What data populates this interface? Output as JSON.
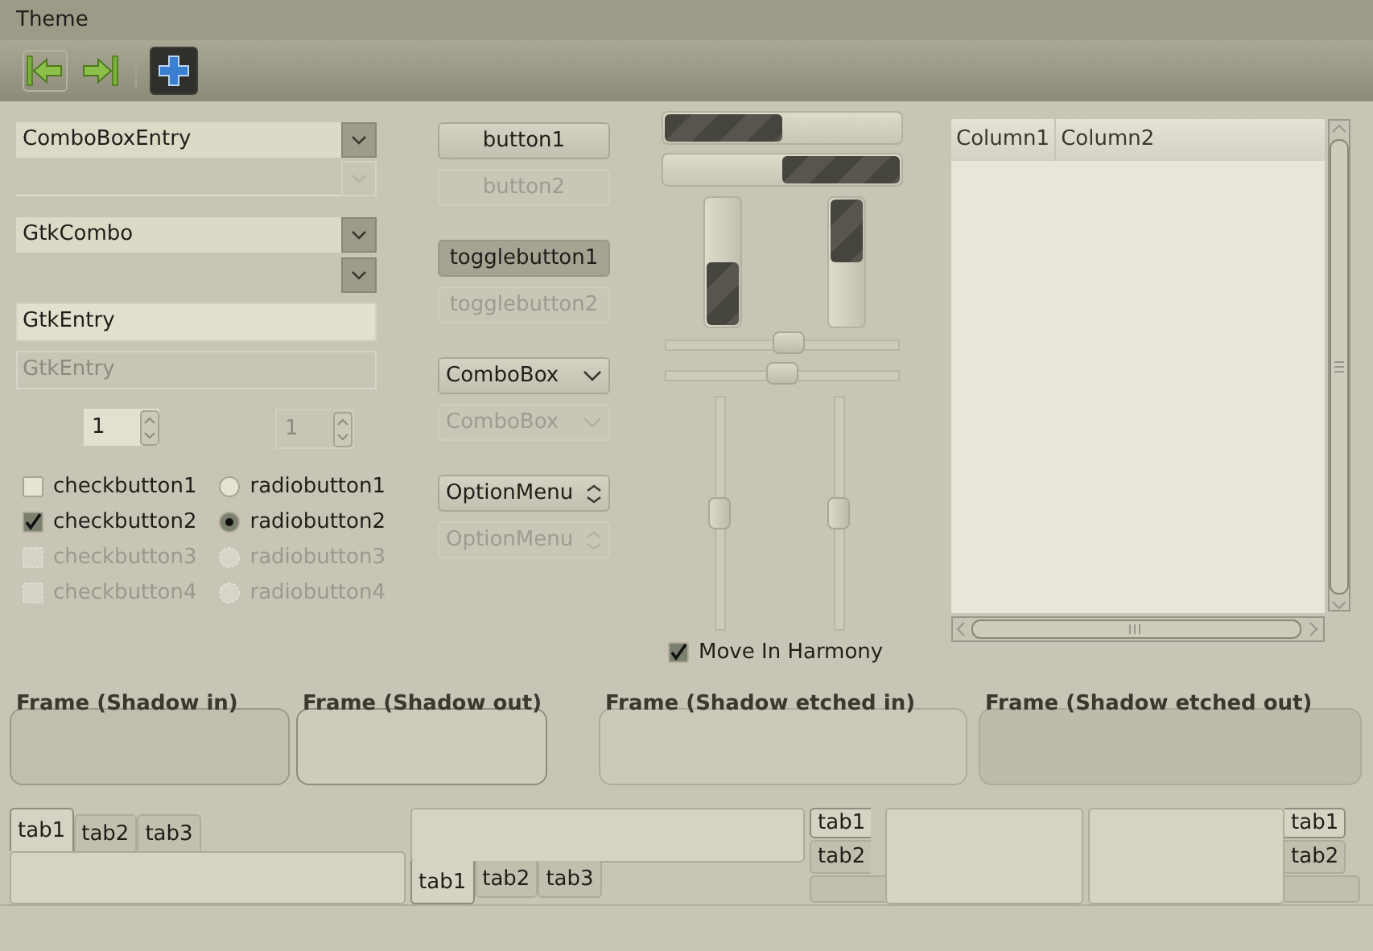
{
  "window": {
    "title": "Theme"
  },
  "toolbar": [
    {
      "kind": "first"
    },
    {
      "kind": "last"
    },
    {
      "kind": "separator"
    },
    {
      "kind": "add"
    }
  ],
  "combo_box_entries": [
    {
      "value": "ComboBoxEntry",
      "disabled": false
    },
    {
      "disabled": true
    }
  ],
  "gtk_combo": {
    "value": "GtkCombo"
  },
  "entries": [
    {
      "value": "GtkEntry",
      "disabled": false
    },
    {
      "value": "GtkEntry",
      "disabled": true
    }
  ],
  "spin_buttons": [
    {
      "value": "1",
      "disabled": false
    },
    {
      "value": "1",
      "disabled": true
    }
  ],
  "check_buttons": [
    {
      "label": "checkbutton1",
      "checked": false,
      "disabled": false
    },
    {
      "label": "checkbutton2",
      "checked": true,
      "disabled": false
    },
    {
      "label": "checkbutton3",
      "checked": false,
      "disabled": true
    },
    {
      "label": "checkbutton4",
      "checked": false,
      "disabled": true
    }
  ],
  "radio_buttons": [
    {
      "label": "radiobutton1",
      "selected": false,
      "disabled": false
    },
    {
      "label": "radiobutton2",
      "selected": true,
      "disabled": false
    },
    {
      "label": "radiobutton3",
      "selected": false,
      "disabled": true
    },
    {
      "label": "radiobutton4",
      "selected": false,
      "disabled": true
    }
  ],
  "buttons": [
    {
      "label": "button1",
      "disabled": false
    },
    {
      "label": "button2",
      "disabled": true
    }
  ],
  "toggle_buttons": [
    {
      "label": "togglebutton1",
      "pressed": true,
      "disabled": false
    },
    {
      "label": "togglebutton2",
      "pressed": false,
      "disabled": true
    }
  ],
  "combo_boxes": [
    {
      "value": "ComboBox",
      "disabled": false
    },
    {
      "value": "ComboBox",
      "disabled": true
    }
  ],
  "option_menus": [
    {
      "value": "OptionMenu",
      "disabled": false
    },
    {
      "value": "OptionMenu",
      "disabled": true
    }
  ],
  "progress_bars": [
    {
      "kind": "left-to-right",
      "level": 0.5
    },
    {
      "kind": "right-to-left",
      "level": 0.5
    }
  ],
  "vertical_progress_bars": [
    {
      "kind": "bottom-to-top",
      "level": 0.5
    },
    {
      "kind": "top-to-bottom",
      "level": 0.5
    }
  ],
  "hscales": [
    {
      "level": 0.53
    },
    {
      "level": 0.5
    }
  ],
  "vscales": [
    {
      "level": 0.5
    },
    {
      "level": 0.5
    }
  ],
  "move_in_harmony": {
    "label": "Move In Harmony",
    "checked": true
  },
  "tree": {
    "columns": [
      "Column1",
      "Column2"
    ]
  },
  "frames": [
    {
      "label": "Frame (Shadow in)",
      "kind": "in"
    },
    {
      "label": "Frame (Shadow out)",
      "kind": "out"
    },
    {
      "label": "Frame (Shadow etched in)",
      "kind": "etchedin"
    },
    {
      "label": "Frame (Shadow etched out)",
      "kind": "etchedout"
    }
  ],
  "notebooks": [
    {
      "kind": "top",
      "tabs": [
        {
          "label": "tab1",
          "selected": true
        },
        {
          "label": "tab2",
          "selected": false
        },
        {
          "label": "tab3",
          "selected": false
        }
      ]
    },
    {
      "kind": "bottom",
      "tabs": [
        {
          "label": "tab1",
          "selected": true
        },
        {
          "label": "tab2",
          "selected": false
        },
        {
          "label": "tab3",
          "selected": false
        }
      ]
    },
    {
      "kind": "left",
      "tabs": [
        {
          "label": "tab1",
          "selected": true
        },
        {
          "label": "tab2",
          "selected": false
        }
      ]
    },
    {
      "kind": "right",
      "tabs": [
        {
          "label": "tab1",
          "selected": true
        },
        {
          "label": "tab2",
          "selected": false
        }
      ]
    }
  ]
}
